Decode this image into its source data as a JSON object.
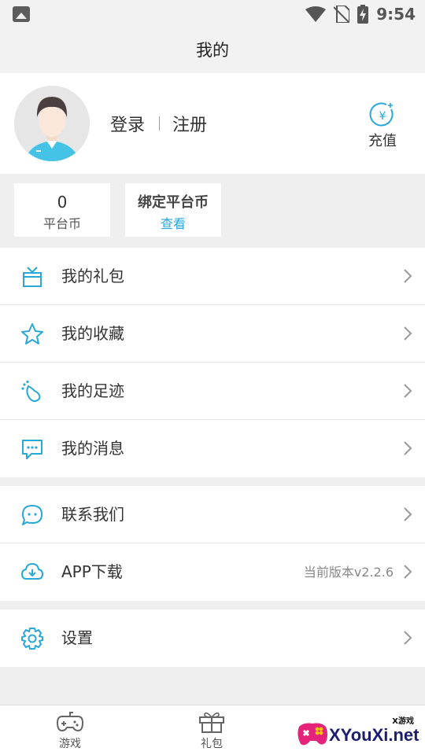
{
  "status": {
    "time": "9:54",
    "icons": [
      "photo-icon",
      "wifi-icon",
      "no-sim-icon",
      "battery-charging-icon"
    ]
  },
  "header": {
    "title": "我的"
  },
  "profile": {
    "login": "登录",
    "register": "注册",
    "recharge": "充值"
  },
  "coins": {
    "platform_value": "0",
    "platform_label": "平台币",
    "bound_title": "绑定平台币",
    "bound_link": "查看"
  },
  "menu": {
    "gift": "我的礼包",
    "favorites": "我的收藏",
    "footprint": "我的足迹",
    "messages": "我的消息",
    "contact": "联系我们",
    "download": "APP下载",
    "version": "当前版本v2.2.6",
    "settings": "设置"
  },
  "tabbar": {
    "games": "游戏",
    "gifts": "礼包"
  },
  "watermark": {
    "brand": "XYouXi.net",
    "small": "X游戏"
  },
  "colors": {
    "accent": "#29a7d6",
    "text": "#333333",
    "background": "#efefef"
  }
}
